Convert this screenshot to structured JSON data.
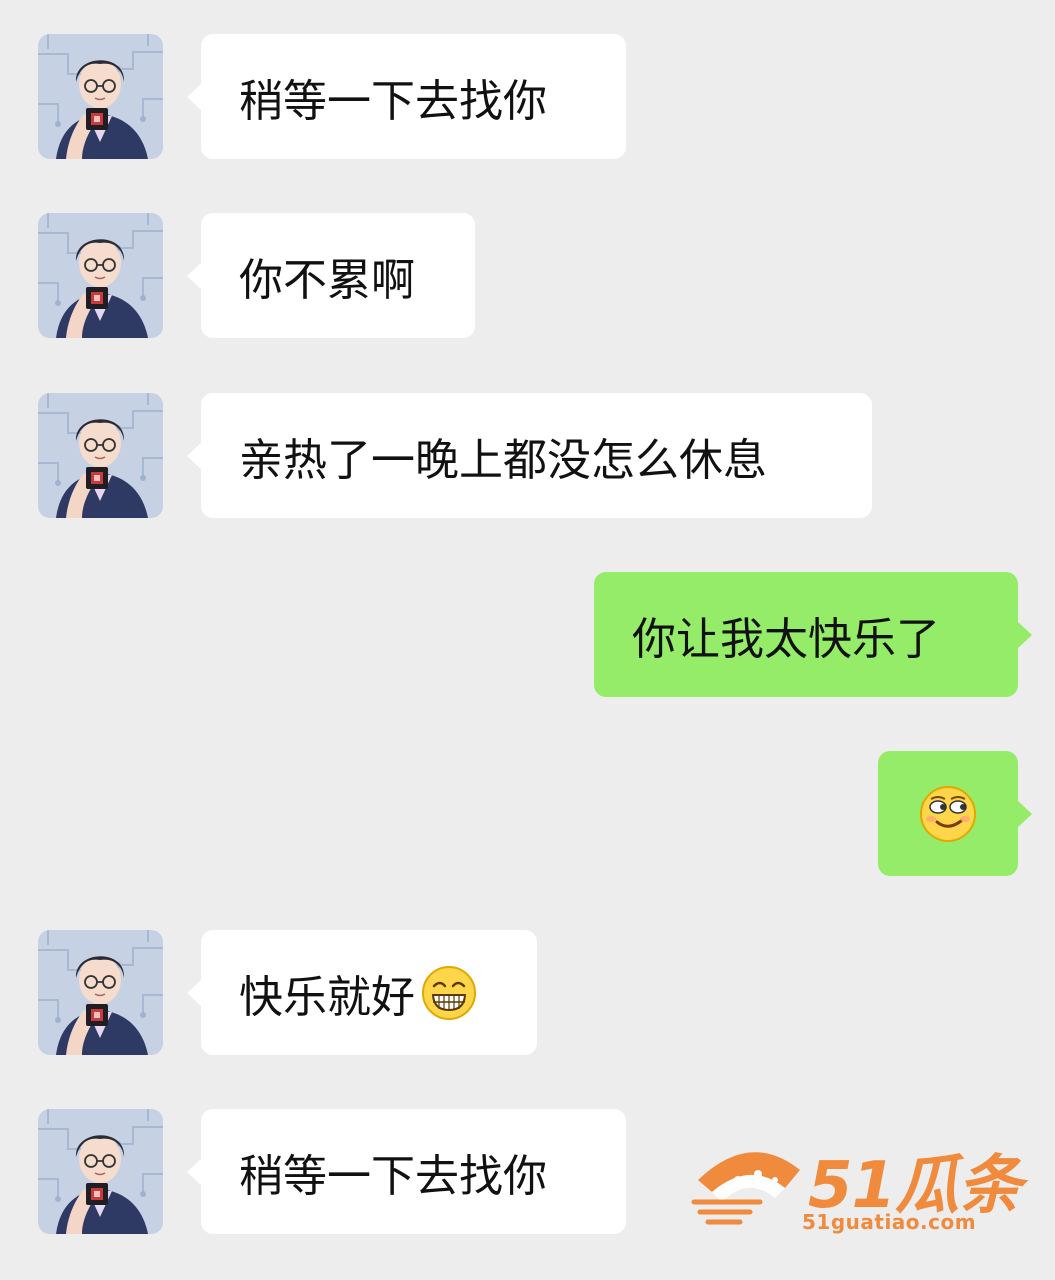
{
  "messages": [
    {
      "side": "in",
      "text": "稍等一下去找你"
    },
    {
      "side": "in",
      "text": "你不累啊"
    },
    {
      "side": "in",
      "text": "亲热了一晚上都没怎么休息"
    },
    {
      "side": "out",
      "text": "你让我太快乐了"
    },
    {
      "side": "out",
      "emoji": "smirk-emoji"
    },
    {
      "side": "in",
      "text": "快乐就好",
      "emoji": "grin-emoji"
    },
    {
      "side": "in",
      "text": "稍等一下去找你"
    }
  ],
  "colors": {
    "background": "#ededed",
    "incoming_bubble": "#ffffff",
    "outgoing_bubble": "#95ec69",
    "watermark": "#f08a3c"
  },
  "watermark": {
    "brand": "51瓜条",
    "url": "51guatiao.com"
  }
}
